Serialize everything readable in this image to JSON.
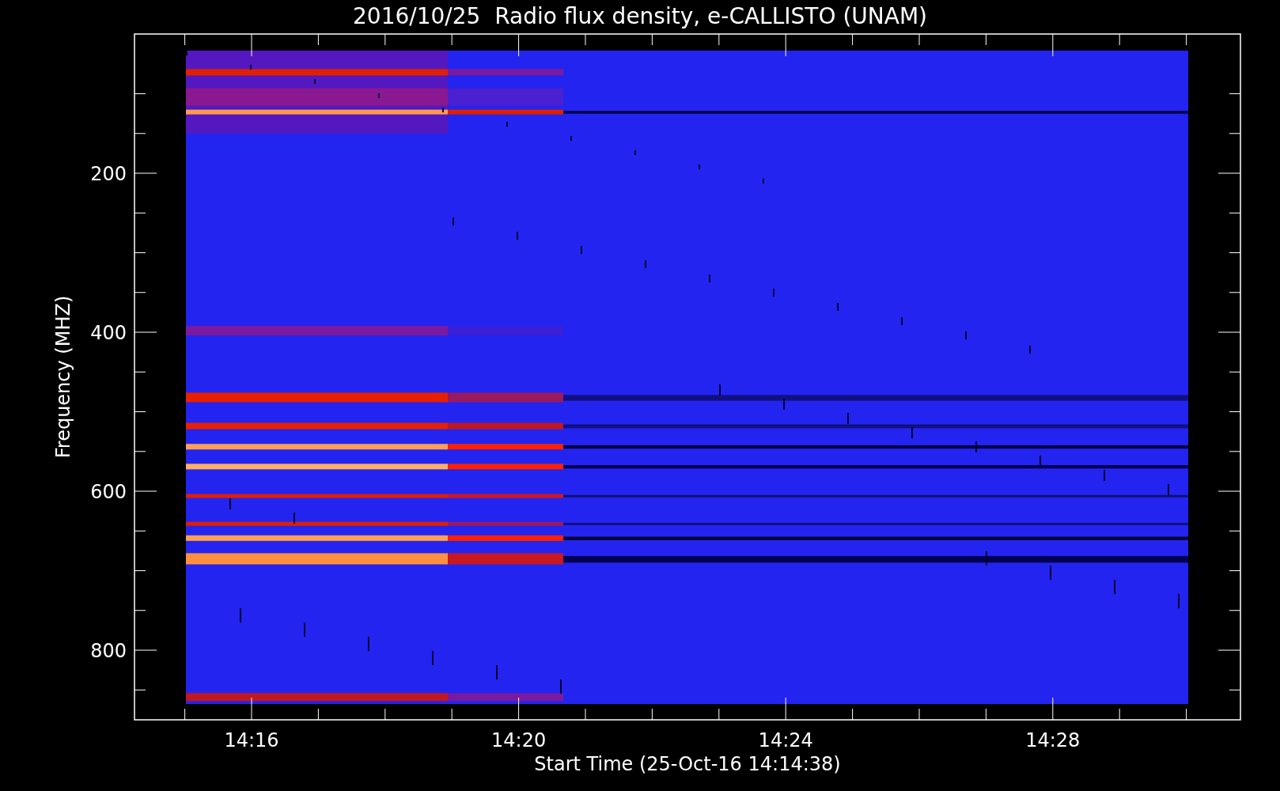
{
  "title": "2016/10/25  Radio flux density, e-CALLISTO (UNAM)",
  "ylabel": "Frequency (MHZ)",
  "xlabel": "Start Time (25-Oct-16 14:14:38)",
  "yticks": [
    "200",
    "400",
    "600",
    "800"
  ],
  "xticks": [
    "14:16",
    "14:20",
    "14:24",
    "14:28"
  ]
}
